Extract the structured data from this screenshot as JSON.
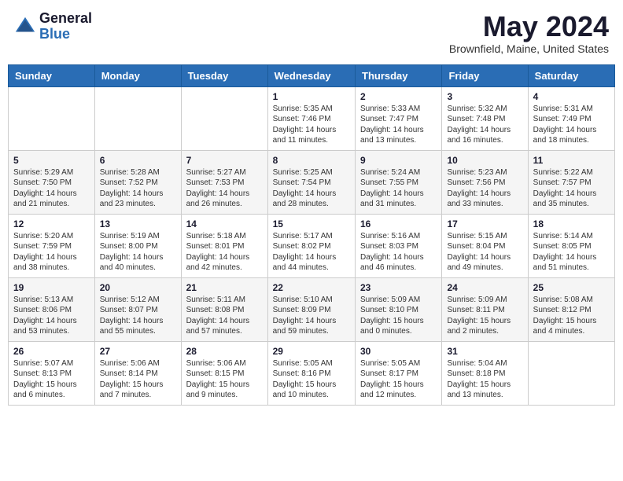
{
  "header": {
    "logo_general": "General",
    "logo_blue": "Blue",
    "main_title": "May 2024",
    "subtitle": "Brownfield, Maine, United States"
  },
  "weekdays": [
    "Sunday",
    "Monday",
    "Tuesday",
    "Wednesday",
    "Thursday",
    "Friday",
    "Saturday"
  ],
  "weeks": [
    [
      {
        "day": "",
        "info": ""
      },
      {
        "day": "",
        "info": ""
      },
      {
        "day": "",
        "info": ""
      },
      {
        "day": "1",
        "info": "Sunrise: 5:35 AM\nSunset: 7:46 PM\nDaylight: 14 hours\nand 11 minutes."
      },
      {
        "day": "2",
        "info": "Sunrise: 5:33 AM\nSunset: 7:47 PM\nDaylight: 14 hours\nand 13 minutes."
      },
      {
        "day": "3",
        "info": "Sunrise: 5:32 AM\nSunset: 7:48 PM\nDaylight: 14 hours\nand 16 minutes."
      },
      {
        "day": "4",
        "info": "Sunrise: 5:31 AM\nSunset: 7:49 PM\nDaylight: 14 hours\nand 18 minutes."
      }
    ],
    [
      {
        "day": "5",
        "info": "Sunrise: 5:29 AM\nSunset: 7:50 PM\nDaylight: 14 hours\nand 21 minutes."
      },
      {
        "day": "6",
        "info": "Sunrise: 5:28 AM\nSunset: 7:52 PM\nDaylight: 14 hours\nand 23 minutes."
      },
      {
        "day": "7",
        "info": "Sunrise: 5:27 AM\nSunset: 7:53 PM\nDaylight: 14 hours\nand 26 minutes."
      },
      {
        "day": "8",
        "info": "Sunrise: 5:25 AM\nSunset: 7:54 PM\nDaylight: 14 hours\nand 28 minutes."
      },
      {
        "day": "9",
        "info": "Sunrise: 5:24 AM\nSunset: 7:55 PM\nDaylight: 14 hours\nand 31 minutes."
      },
      {
        "day": "10",
        "info": "Sunrise: 5:23 AM\nSunset: 7:56 PM\nDaylight: 14 hours\nand 33 minutes."
      },
      {
        "day": "11",
        "info": "Sunrise: 5:22 AM\nSunset: 7:57 PM\nDaylight: 14 hours\nand 35 minutes."
      }
    ],
    [
      {
        "day": "12",
        "info": "Sunrise: 5:20 AM\nSunset: 7:59 PM\nDaylight: 14 hours\nand 38 minutes."
      },
      {
        "day": "13",
        "info": "Sunrise: 5:19 AM\nSunset: 8:00 PM\nDaylight: 14 hours\nand 40 minutes."
      },
      {
        "day": "14",
        "info": "Sunrise: 5:18 AM\nSunset: 8:01 PM\nDaylight: 14 hours\nand 42 minutes."
      },
      {
        "day": "15",
        "info": "Sunrise: 5:17 AM\nSunset: 8:02 PM\nDaylight: 14 hours\nand 44 minutes."
      },
      {
        "day": "16",
        "info": "Sunrise: 5:16 AM\nSunset: 8:03 PM\nDaylight: 14 hours\nand 46 minutes."
      },
      {
        "day": "17",
        "info": "Sunrise: 5:15 AM\nSunset: 8:04 PM\nDaylight: 14 hours\nand 49 minutes."
      },
      {
        "day": "18",
        "info": "Sunrise: 5:14 AM\nSunset: 8:05 PM\nDaylight: 14 hours\nand 51 minutes."
      }
    ],
    [
      {
        "day": "19",
        "info": "Sunrise: 5:13 AM\nSunset: 8:06 PM\nDaylight: 14 hours\nand 53 minutes."
      },
      {
        "day": "20",
        "info": "Sunrise: 5:12 AM\nSunset: 8:07 PM\nDaylight: 14 hours\nand 55 minutes."
      },
      {
        "day": "21",
        "info": "Sunrise: 5:11 AM\nSunset: 8:08 PM\nDaylight: 14 hours\nand 57 minutes."
      },
      {
        "day": "22",
        "info": "Sunrise: 5:10 AM\nSunset: 8:09 PM\nDaylight: 14 hours\nand 59 minutes."
      },
      {
        "day": "23",
        "info": "Sunrise: 5:09 AM\nSunset: 8:10 PM\nDaylight: 15 hours\nand 0 minutes."
      },
      {
        "day": "24",
        "info": "Sunrise: 5:09 AM\nSunset: 8:11 PM\nDaylight: 15 hours\nand 2 minutes."
      },
      {
        "day": "25",
        "info": "Sunrise: 5:08 AM\nSunset: 8:12 PM\nDaylight: 15 hours\nand 4 minutes."
      }
    ],
    [
      {
        "day": "26",
        "info": "Sunrise: 5:07 AM\nSunset: 8:13 PM\nDaylight: 15 hours\nand 6 minutes."
      },
      {
        "day": "27",
        "info": "Sunrise: 5:06 AM\nSunset: 8:14 PM\nDaylight: 15 hours\nand 7 minutes."
      },
      {
        "day": "28",
        "info": "Sunrise: 5:06 AM\nSunset: 8:15 PM\nDaylight: 15 hours\nand 9 minutes."
      },
      {
        "day": "29",
        "info": "Sunrise: 5:05 AM\nSunset: 8:16 PM\nDaylight: 15 hours\nand 10 minutes."
      },
      {
        "day": "30",
        "info": "Sunrise: 5:05 AM\nSunset: 8:17 PM\nDaylight: 15 hours\nand 12 minutes."
      },
      {
        "day": "31",
        "info": "Sunrise: 5:04 AM\nSunset: 8:18 PM\nDaylight: 15 hours\nand 13 minutes."
      },
      {
        "day": "",
        "info": ""
      }
    ]
  ]
}
